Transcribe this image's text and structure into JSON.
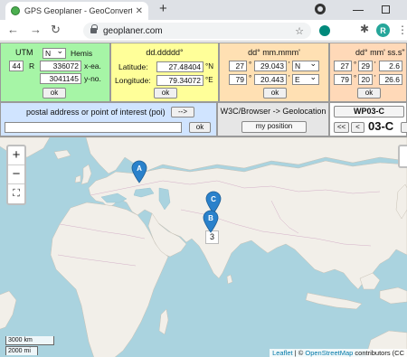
{
  "browser": {
    "tab_title": "GPS Geoplaner - GeoConverter |",
    "url": "geoplaner.com",
    "profile_initial": "R"
  },
  "utm": {
    "title": "UTM",
    "hemisphere": "N",
    "hemis_label": "Hemis",
    "zone": "44",
    "band": "R",
    "easting": "336072",
    "easting_label": "x-ea.",
    "northing": "3041145",
    "northing_label": "y-no.",
    "ok_label": "ok"
  },
  "dd": {
    "title": "dd.ddddd°",
    "lat_label": "Latitude:",
    "lat_value": "27.48404",
    "lat_dir": "°N",
    "lon_label": "Longitude:",
    "lon_value": "79.34072",
    "lon_dir": "°E",
    "ok_label": "ok"
  },
  "dmm": {
    "title": "dd° mm.mmm'",
    "lat_deg": "27",
    "lat_min": "29.043",
    "lat_hem": "N",
    "lon_deg": "79",
    "lon_min": "20.443",
    "lon_hem": "E",
    "deg_sym": "°",
    "min_sym": "'",
    "ok_label": "ok"
  },
  "dms": {
    "title": "dd° mm' ss.s\"",
    "lat_deg": "27",
    "lat_min": "29",
    "lat_sec": "2.6",
    "lon_deg": "79",
    "lon_min": "20",
    "lon_sec": "26.6",
    "deg_sym": "°",
    "min_sym": "'",
    "ok_label": "ok"
  },
  "poi": {
    "label": "postal address or  point of interest (poi)",
    "arrow_button": "-->",
    "input_value": "",
    "ok_label": "ok"
  },
  "geolocation": {
    "title": "W3C/Browser -> Geolocation",
    "button": "my position"
  },
  "waypoint": {
    "name": "WP03-C",
    "first_btn": "<<",
    "prev_btn": "<",
    "code": "03-C"
  },
  "map": {
    "zoom_in": "+",
    "zoom_out": "−",
    "fullscreen": "⛶",
    "cluster_count": "3",
    "markers": [
      {
        "label": "A",
        "lat": 48.8,
        "lon": 10.5
      },
      {
        "label": "C",
        "lat": 27.5,
        "lon": 79.3
      },
      {
        "label": "B",
        "lat": 11.0,
        "lon": 77.0
      }
    ],
    "scale_km": "3000 km",
    "scale_mi": "2000 mi",
    "attribution_leaflet": "Leaflet",
    "attribution_sep": " | © ",
    "attribution_osm": "OpenStreetMap",
    "attribution_rest": " contributors (CC"
  },
  "colors": {
    "utm_bg": "#a6f5a6",
    "dd_bg": "#ffff99",
    "dmm_bg": "#ffe0b3",
    "poi_bg": "#d0e4ff",
    "marker": "#2a81cb",
    "land": "#f2efe9",
    "water": "#aad3df"
  }
}
